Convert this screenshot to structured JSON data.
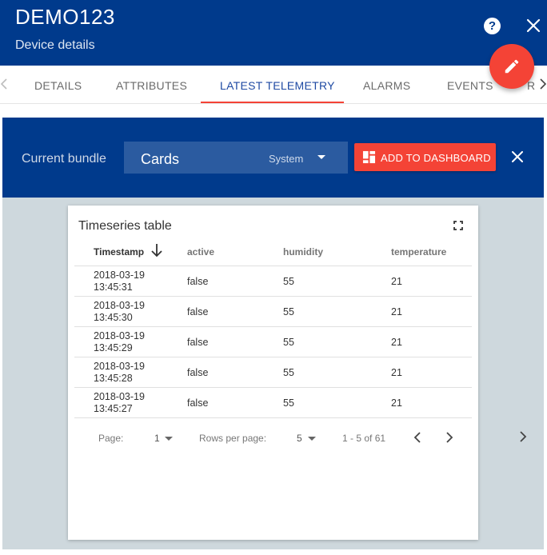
{
  "header": {
    "title": "DEMO123",
    "subtitle": "Device details"
  },
  "tabs": [
    {
      "label": "DETAILS"
    },
    {
      "label": "ATTRIBUTES"
    },
    {
      "label": "LATEST TELEMETRY",
      "active": true
    },
    {
      "label": "ALARMS"
    },
    {
      "label": "EVENTS"
    },
    {
      "label": "R"
    }
  ],
  "toolbar": {
    "bundle_label": "Current bundle",
    "bundle_value": "Cards",
    "bundle_meta": "System",
    "add_button": "ADD TO DASHBOARD"
  },
  "widget": {
    "title": "Timeseries table",
    "columns": [
      "Timestamp",
      "active",
      "humidity",
      "temperature"
    ],
    "rows": [
      {
        "date": "2018-03-19",
        "time": "13:45:31",
        "active": "false",
        "humidity": "55",
        "temperature": "21"
      },
      {
        "date": "2018-03-19",
        "time": "13:45:30",
        "active": "false",
        "humidity": "55",
        "temperature": "21"
      },
      {
        "date": "2018-03-19",
        "time": "13:45:29",
        "active": "false",
        "humidity": "55",
        "temperature": "21"
      },
      {
        "date": "2018-03-19",
        "time": "13:45:28",
        "active": "false",
        "humidity": "55",
        "temperature": "21"
      },
      {
        "date": "2018-03-19",
        "time": "13:45:27",
        "active": "false",
        "humidity": "55",
        "temperature": "21"
      }
    ],
    "pager": {
      "page_label": "Page:",
      "page_value": "1",
      "rows_label": "Rows per page:",
      "rows_value": "5",
      "range": "1 - 5 of 61"
    }
  },
  "colors": {
    "header_bg": "#003a8c",
    "accent": "#f44336",
    "active_tab": "#1f4aa3",
    "dashboard_bg": "#ced8dd"
  },
  "icons": [
    "help-icon",
    "close-icon",
    "edit-icon",
    "chevron-left-icon",
    "chevron-right-icon",
    "dashboard-icon",
    "fullscreen-icon",
    "arrow-down-icon",
    "caret-down-icon"
  ]
}
